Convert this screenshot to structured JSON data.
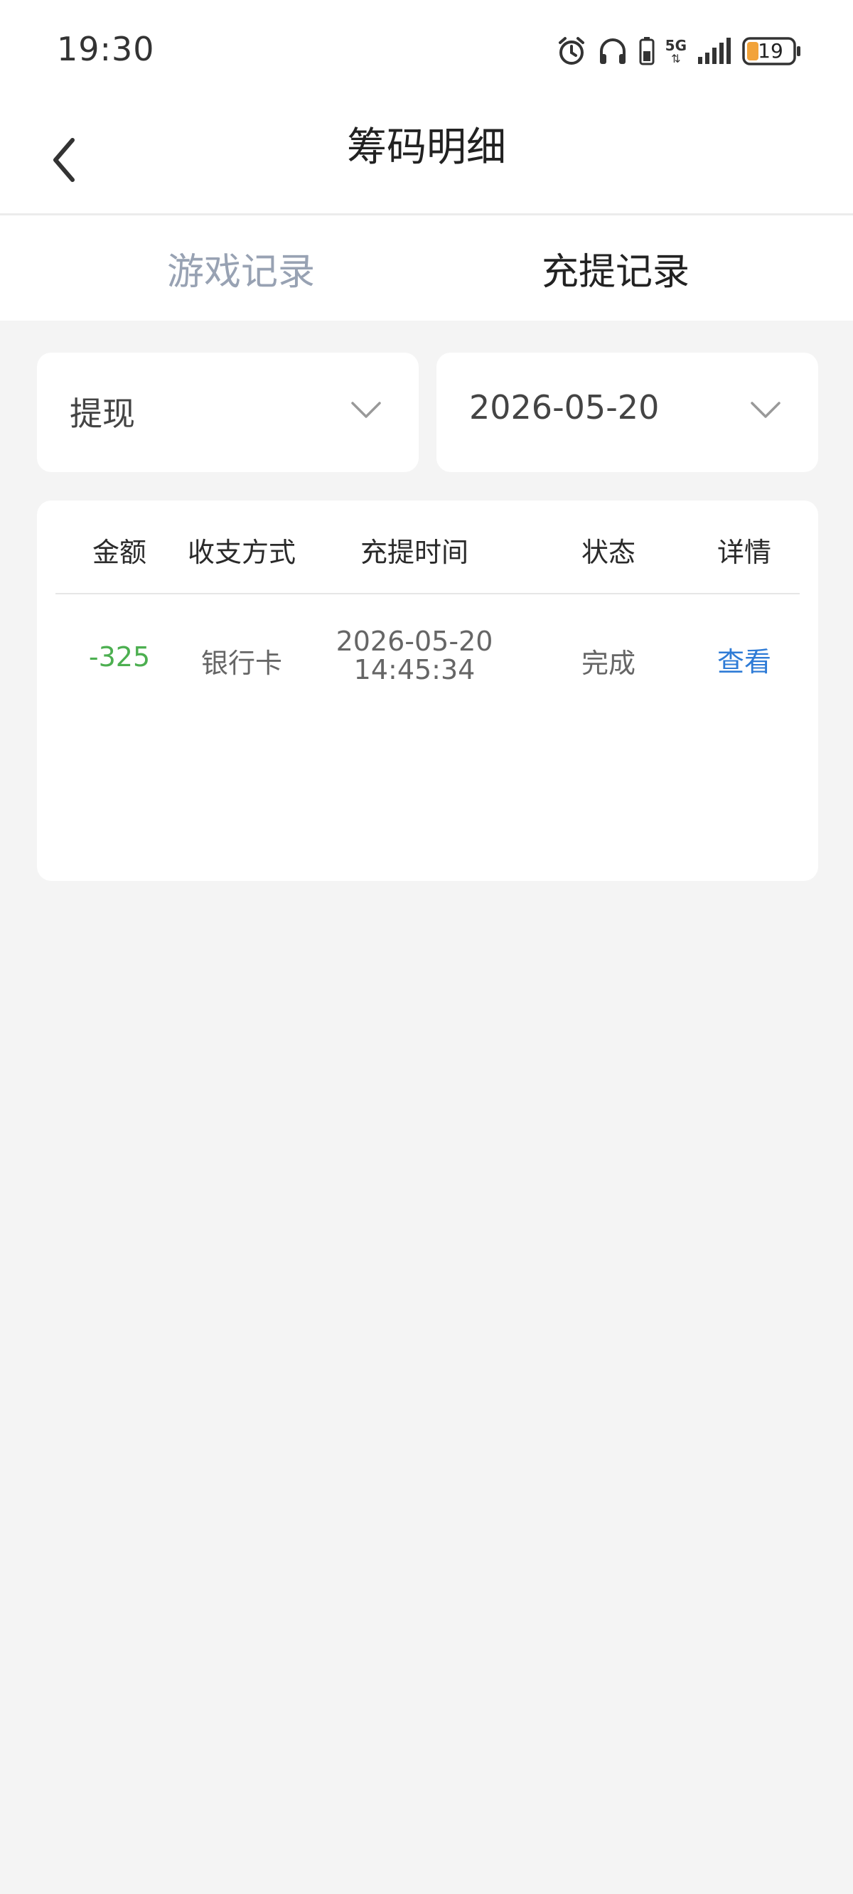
{
  "status_bar": {
    "time": "19:30",
    "network_label": "5G",
    "battery_level": "19"
  },
  "header": {
    "title": "筹码明细"
  },
  "tabs": [
    {
      "label": "游戏记录",
      "active": false
    },
    {
      "label": "充提记录",
      "active": true
    }
  ],
  "filters": {
    "type": "提现",
    "date": "2026-05-20"
  },
  "table": {
    "headers": [
      "金额",
      "收支方式",
      "充提时间",
      "状态",
      "详情"
    ],
    "rows": [
      {
        "amount": "-325",
        "method": "银行卡",
        "date": "2026-05-20",
        "time": "14:45:34",
        "status": "完成",
        "detail": "查看"
      }
    ]
  },
  "colors": {
    "background": "#f4f4f4",
    "amount_negative": "#4caf50",
    "link": "#2e7bd6",
    "tab_inactive": "#98a2b3"
  }
}
